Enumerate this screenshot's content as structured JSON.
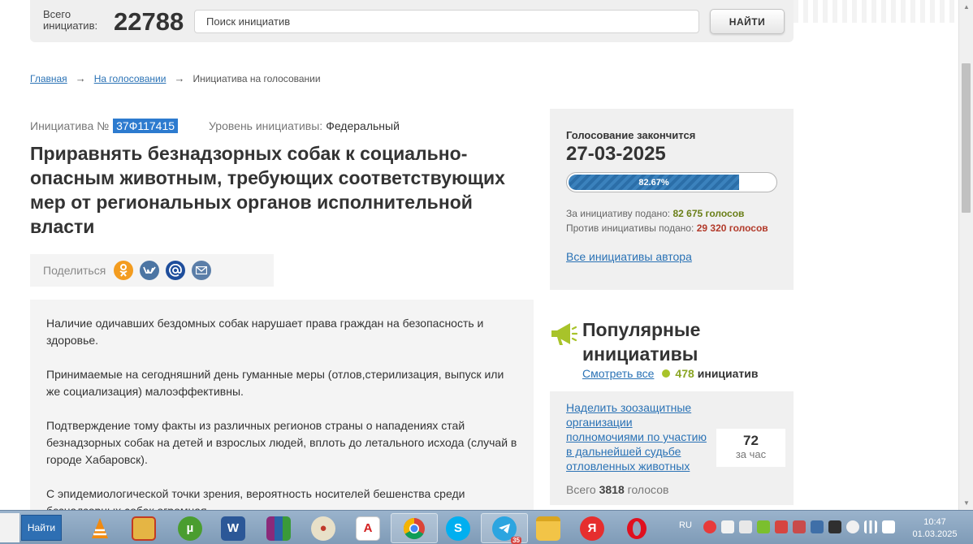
{
  "header": {
    "total_label_line1": "Всего",
    "total_label_line2": "инициатив:",
    "total_count": "22788",
    "search_placeholder": "Поиск инициатив",
    "search_button": "НАЙТИ"
  },
  "breadcrumb": {
    "items": [
      "Главная",
      "На голосовании",
      "Инициатива на голосовании"
    ],
    "separator": "→"
  },
  "initiative": {
    "number_label": "Инициатива №",
    "number": "37Ф117415",
    "level_label": "Уровень инициативы:",
    "level_value": "Федеральный",
    "title": "Приравнять безнадзорных собак к социально-опасным животным, требующих соответствующих мер от региональных органов исполнительной власти",
    "share_label": "Поделиться",
    "share_icons": [
      "odnoklassniki-icon",
      "vk-icon",
      "mail-ru-icon",
      "email-icon"
    ],
    "description": [
      "Наличие одичавших бездомных собак нарушает права граждан на безопасность и здоровье.",
      "Принимаемые на сегодняшний день гуманные меры (отлов,стерилизация, выпуск или же социализация) малоэффективны.",
      "Подтверждение тому факты из различных регионов страны о нападениях стай безнадзорных собак на детей и взрослых людей, вплоть до летального исхода (случай в городе Хабаровск).",
      "С эпидемиологической точки зрения, вероятность носителей бешенства среди безнадзорных собак огромная."
    ]
  },
  "voting": {
    "end_label": "Голосование закончится",
    "end_date": "27-03-2025",
    "progress_percent": 82.67,
    "progress_label": "82.67%",
    "for_label": "За инициативу подано:",
    "for_value": "82 675 голосов",
    "against_label": "Против инициативы подано:",
    "against_value": "29 320 голосов",
    "author_link": "Все инициативы автора"
  },
  "popular": {
    "title": "Популярные инициативы",
    "see_all": "Смотреть все",
    "count": "478",
    "count_word": "инициатив",
    "card": {
      "link": "Наделить зоозащитные организации полномочиями по участию в дальнейшей судьбе отловленных животных",
      "rate_value": "72",
      "rate_unit": "за час",
      "total_label": "Всего",
      "total_value": "3818",
      "total_unit": "голосов"
    }
  },
  "taskbar": {
    "search_label": "Найти",
    "apps": [
      "vlc-icon",
      "file-manager-icon",
      "utorrent-icon",
      "word-icon",
      "winrar-icon",
      "paint-icon",
      "acrobat-icon",
      "chrome-icon",
      "skype-icon",
      "telegram-icon",
      "explorer-icon",
      "yandex-icon",
      "opera-icon"
    ],
    "telegram_badge": "35",
    "language": "RU",
    "time": "10:47",
    "date": "01.03.2025"
  },
  "colors": {
    "link": "#2a72b5",
    "id_highlight": "#2d7bcf",
    "progress": "#2b6ea8",
    "votes_for": "#6a7f18",
    "votes_against": "#b23a2a",
    "popular_dot": "#a8c32a",
    "odnoklassniki": "#f39c1f",
    "vk": "#4c75a3",
    "mail_ru": "#1f4e9c",
    "email": "#5b7ea8"
  }
}
